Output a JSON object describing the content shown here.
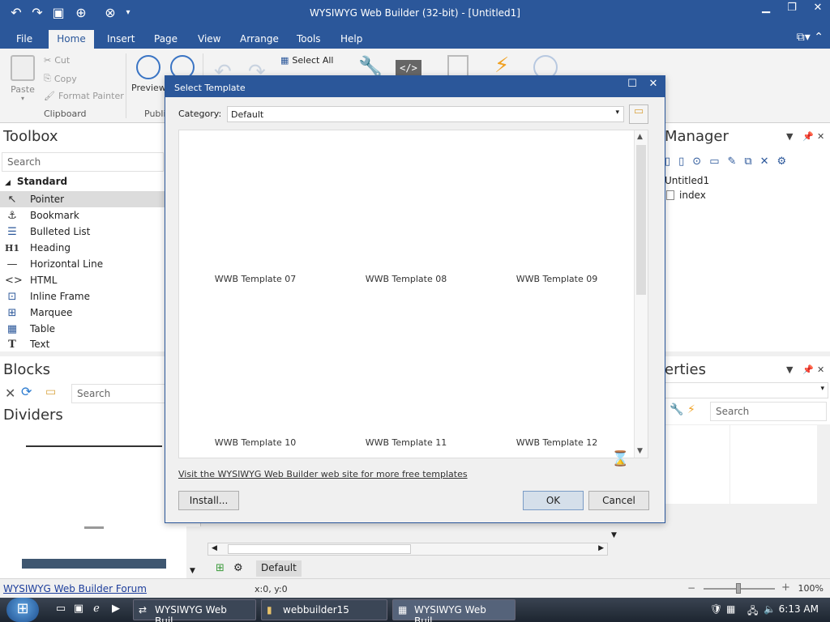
{
  "window": {
    "title": "WYSIWYG Web Builder (32-bit) - [Untitled1]"
  },
  "menu": {
    "tabs": [
      "File",
      "Home",
      "Insert",
      "Page",
      "View",
      "Arrange",
      "Tools",
      "Help"
    ],
    "active": "Home"
  },
  "ribbon": {
    "paste": "Paste",
    "cut": "Cut",
    "copy": "Copy",
    "format_painter": "Format Painter",
    "clipboard_group": "Clipboard",
    "preview": "Preview",
    "publish_group": "Publi",
    "select_all": "Select All"
  },
  "toolbox": {
    "title": "Toolbox",
    "search_placeholder": "Search",
    "section": "Standard",
    "items": [
      {
        "label": "Pointer",
        "icon": "pointer-icon"
      },
      {
        "label": "Bookmark",
        "icon": "anchor-icon"
      },
      {
        "label": "Bulleted List",
        "icon": "list-icon"
      },
      {
        "label": "Heading",
        "icon": "heading-icon"
      },
      {
        "label": "Horizontal Line",
        "icon": "line-icon"
      },
      {
        "label": "HTML",
        "icon": "code-icon"
      },
      {
        "label": "Inline Frame",
        "icon": "frame-icon"
      },
      {
        "label": "Marquee",
        "icon": "marquee-icon"
      },
      {
        "label": "Table",
        "icon": "table-icon"
      },
      {
        "label": "Text",
        "icon": "text-icon"
      }
    ]
  },
  "blocks": {
    "title": "Blocks",
    "search_placeholder": "Search",
    "category": "Dividers"
  },
  "site_manager": {
    "title": "Manager",
    "root": "Untitled1",
    "page": "index"
  },
  "properties": {
    "title": "erties",
    "search_placeholder": "Search"
  },
  "dialog": {
    "title": "Select Template",
    "category_label": "Category:",
    "category_value": "Default",
    "templates": [
      "WWB Template 07",
      "WWB Template 08",
      "WWB Template 09",
      "WWB Template 10",
      "WWB Template 11",
      "WWB Template 12"
    ],
    "link_text": "Visit the WYSIWYG Web Builder web site for more free templates",
    "install_label": "Install...",
    "ok_label": "OK",
    "cancel_label": "Cancel"
  },
  "workspace": {
    "page_tab": "Default"
  },
  "statusbar": {
    "forum_link": "WYSIWYG Web Builder Forum",
    "coords": "x:0, y:0",
    "zoom": "100%",
    "zoom_level": 0.5
  },
  "taskbar": {
    "tasks": [
      {
        "label": "WYSIWYG Web Buil...",
        "icon": "ftp-icon",
        "active": false
      },
      {
        "label": "webbuilder15",
        "icon": "folder-icon",
        "active": false
      },
      {
        "label": "WYSIWYG Web Buil...",
        "icon": "wwb-icon",
        "active": true
      }
    ],
    "clock": "6:13 AM"
  },
  "colors": {
    "accent": "#2b579a",
    "dialog_bg": "#f0f0f0",
    "ok_button": "#d5dfea"
  }
}
